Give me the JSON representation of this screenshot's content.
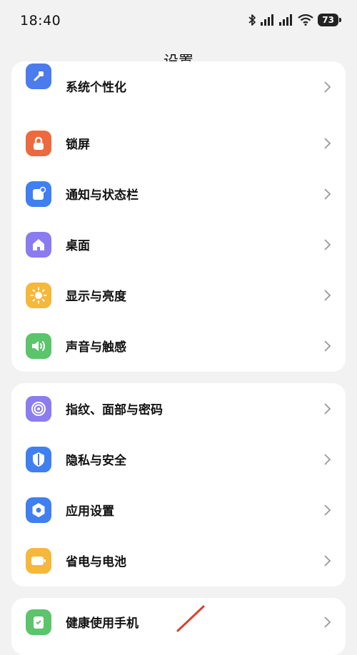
{
  "status_bar": {
    "time": "18:40",
    "battery": "73"
  },
  "header": {
    "title": "设置"
  },
  "groups": [
    {
      "items": [
        {
          "label": "系统个性化",
          "icon": "palette-icon",
          "color": "#4b7bec"
        },
        {
          "label": "锁屏",
          "icon": "lock-icon",
          "color": "#ec6a3d"
        },
        {
          "label": "通知与状态栏",
          "icon": "notification-icon",
          "color": "#3f7ff0"
        },
        {
          "label": "桌面",
          "icon": "home-icon",
          "color": "#8a7bf0"
        },
        {
          "label": "显示与亮度",
          "icon": "sun-icon",
          "color": "#f5b83a"
        },
        {
          "label": "声音与触感",
          "icon": "speaker-icon",
          "color": "#5cc46a"
        }
      ]
    },
    {
      "items": [
        {
          "label": "指纹、面部与密码",
          "icon": "fingerprint-icon",
          "color": "#8b7cf0"
        },
        {
          "label": "隐私与安全",
          "icon": "shield-icon",
          "color": "#3f7ff0"
        },
        {
          "label": "应用设置",
          "icon": "app-settings-icon",
          "color": "#3f7ff0"
        },
        {
          "label": "省电与电池",
          "icon": "battery-icon",
          "color": "#f5b83a"
        }
      ]
    },
    {
      "items": [
        {
          "label": "健康使用手机",
          "icon": "health-icon",
          "color": "#5cc46a"
        }
      ]
    }
  ]
}
